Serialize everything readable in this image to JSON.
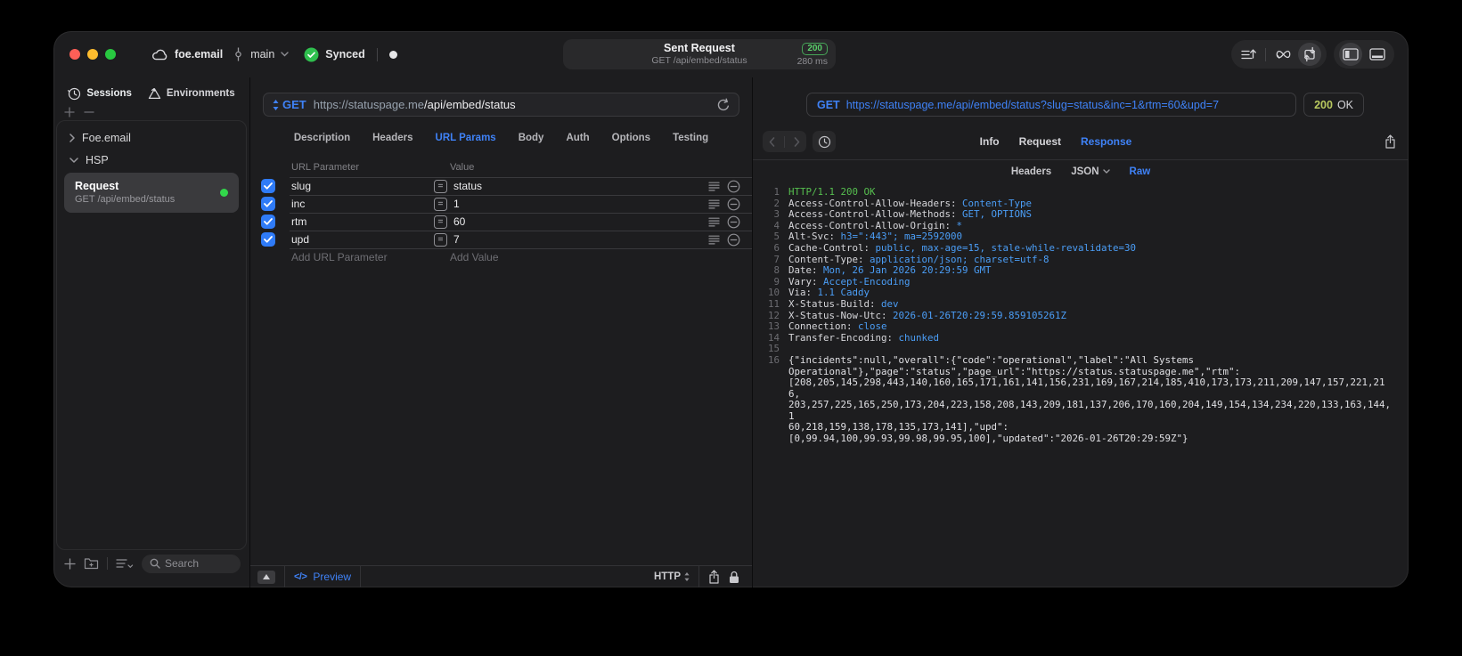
{
  "colors": {
    "panel": "#1d1d1f",
    "accent_blue": "#3f82f7",
    "value_blue": "#4b9ef7",
    "green": "#32d74b",
    "status_green": "#56bf4f",
    "olive_status": "#b9c95f",
    "text": "#e8e8ea",
    "muted": "#8e8e93"
  },
  "titlebar": {
    "project": "foe.email",
    "branch": "main",
    "sync_status": "Synced",
    "title": "Sent Request",
    "subtitle": "GET /api/embed/status",
    "status_badge": "200",
    "duration": "280 ms"
  },
  "sidebar": {
    "tabs": [
      {
        "label": "Sessions",
        "icon": "history-icon",
        "active": true
      },
      {
        "label": "Environments",
        "icon": "environments-icon",
        "active": false
      }
    ],
    "tree": [
      {
        "label": "Foe.email",
        "expanded": false
      },
      {
        "label": "HSP",
        "expanded": true
      }
    ],
    "request_item": {
      "title": "Request",
      "subtitle": "GET /api/embed/status"
    },
    "search_placeholder": "Search"
  },
  "request": {
    "method": "GET",
    "url_scheme": "https://",
    "url_host": "statuspage.me",
    "url_path": "/api/embed/status",
    "tabs": [
      {
        "label": "Description",
        "active": false
      },
      {
        "label": "Headers",
        "active": false
      },
      {
        "label": "URL Params",
        "active": true
      },
      {
        "label": "Body",
        "active": false
      },
      {
        "label": "Auth",
        "active": false
      },
      {
        "label": "Options",
        "active": false
      },
      {
        "label": "Testing",
        "active": false
      }
    ],
    "params": {
      "columns": [
        "URL Parameter",
        "Value"
      ],
      "rows": [
        {
          "name": "slug",
          "value": "status",
          "enabled": true
        },
        {
          "name": "inc",
          "value": "1",
          "enabled": true
        },
        {
          "name": "rtm",
          "value": "60",
          "enabled": true
        },
        {
          "name": "upd",
          "value": "7",
          "enabled": true
        }
      ],
      "add_name_placeholder": "Add URL Parameter",
      "add_value_placeholder": "Add Value"
    },
    "footer": {
      "preview_label": "Preview",
      "protocol": "HTTP"
    }
  },
  "response": {
    "method": "GET",
    "url": "https://statuspage.me/api/embed/status?slug=status&inc=1&rtm=60&upd=7",
    "status_code": "200",
    "status_text": "OK",
    "tabs": [
      {
        "label": "Info",
        "active": false
      },
      {
        "label": "Request",
        "active": false
      },
      {
        "label": "Response",
        "active": true
      }
    ],
    "subtabs": [
      {
        "label": "Headers",
        "active": false,
        "dropdown": false
      },
      {
        "label": "JSON",
        "active": false,
        "dropdown": true
      },
      {
        "label": "Raw",
        "active": true,
        "dropdown": false
      }
    ],
    "body": {
      "lines": [
        {
          "n": "1",
          "type": "status",
          "text": "HTTP/1.1 200 OK"
        },
        {
          "n": "2",
          "type": "header",
          "key": "Access-Control-Allow-Headers",
          "value": "Content-Type"
        },
        {
          "n": "3",
          "type": "header",
          "key": "Access-Control-Allow-Methods",
          "value": "GET, OPTIONS"
        },
        {
          "n": "4",
          "type": "header",
          "key": "Access-Control-Allow-Origin",
          "value": "*"
        },
        {
          "n": "5",
          "type": "header",
          "key": "Alt-Svc",
          "value": "h3=\":443\"; ma=2592000"
        },
        {
          "n": "6",
          "type": "header",
          "key": "Cache-Control",
          "value": "public, max-age=15, stale-while-revalidate=30"
        },
        {
          "n": "7",
          "type": "header",
          "key": "Content-Type",
          "value": "application/json; charset=utf-8"
        },
        {
          "n": "8",
          "type": "header",
          "key": "Date",
          "value": "Mon, 26 Jan 2026 20:29:59 GMT"
        },
        {
          "n": "9",
          "type": "header",
          "key": "Vary",
          "value": "Accept-Encoding"
        },
        {
          "n": "10",
          "type": "header",
          "key": "Via",
          "value": "1.1 Caddy"
        },
        {
          "n": "11",
          "type": "header",
          "key": "X-Status-Build",
          "value": "dev"
        },
        {
          "n": "12",
          "type": "header",
          "key": "X-Status-Now-Utc",
          "value": "2026-01-26T20:29:59.859105261Z"
        },
        {
          "n": "13",
          "type": "header",
          "key": "Connection",
          "value": "close"
        },
        {
          "n": "14",
          "type": "header",
          "key": "Transfer-Encoding",
          "value": "chunked"
        },
        {
          "n": "15",
          "type": "blank"
        },
        {
          "n": "16",
          "type": "json",
          "rows": [
            "{\"incidents\":null,\"overall\":{\"code\":\"operational\",\"label\":\"All Systems",
            "Operational\"},\"page\":\"status\",\"page_url\":\"https://status.statuspage.me\",\"rtm\":",
            "[208,205,145,298,443,140,160,165,171,161,141,156,231,169,167,214,185,410,173,173,211,209,147,157,221,216,",
            "203,257,225,165,250,173,204,223,158,208,143,209,181,137,206,170,160,204,149,154,134,234,220,133,163,144,1",
            "60,218,159,138,178,135,173,141],\"upd\":",
            "[0,99.94,100,99.93,99.98,99.95,100],\"updated\":\"2026-01-26T20:29:59Z\"}"
          ]
        }
      ]
    }
  }
}
